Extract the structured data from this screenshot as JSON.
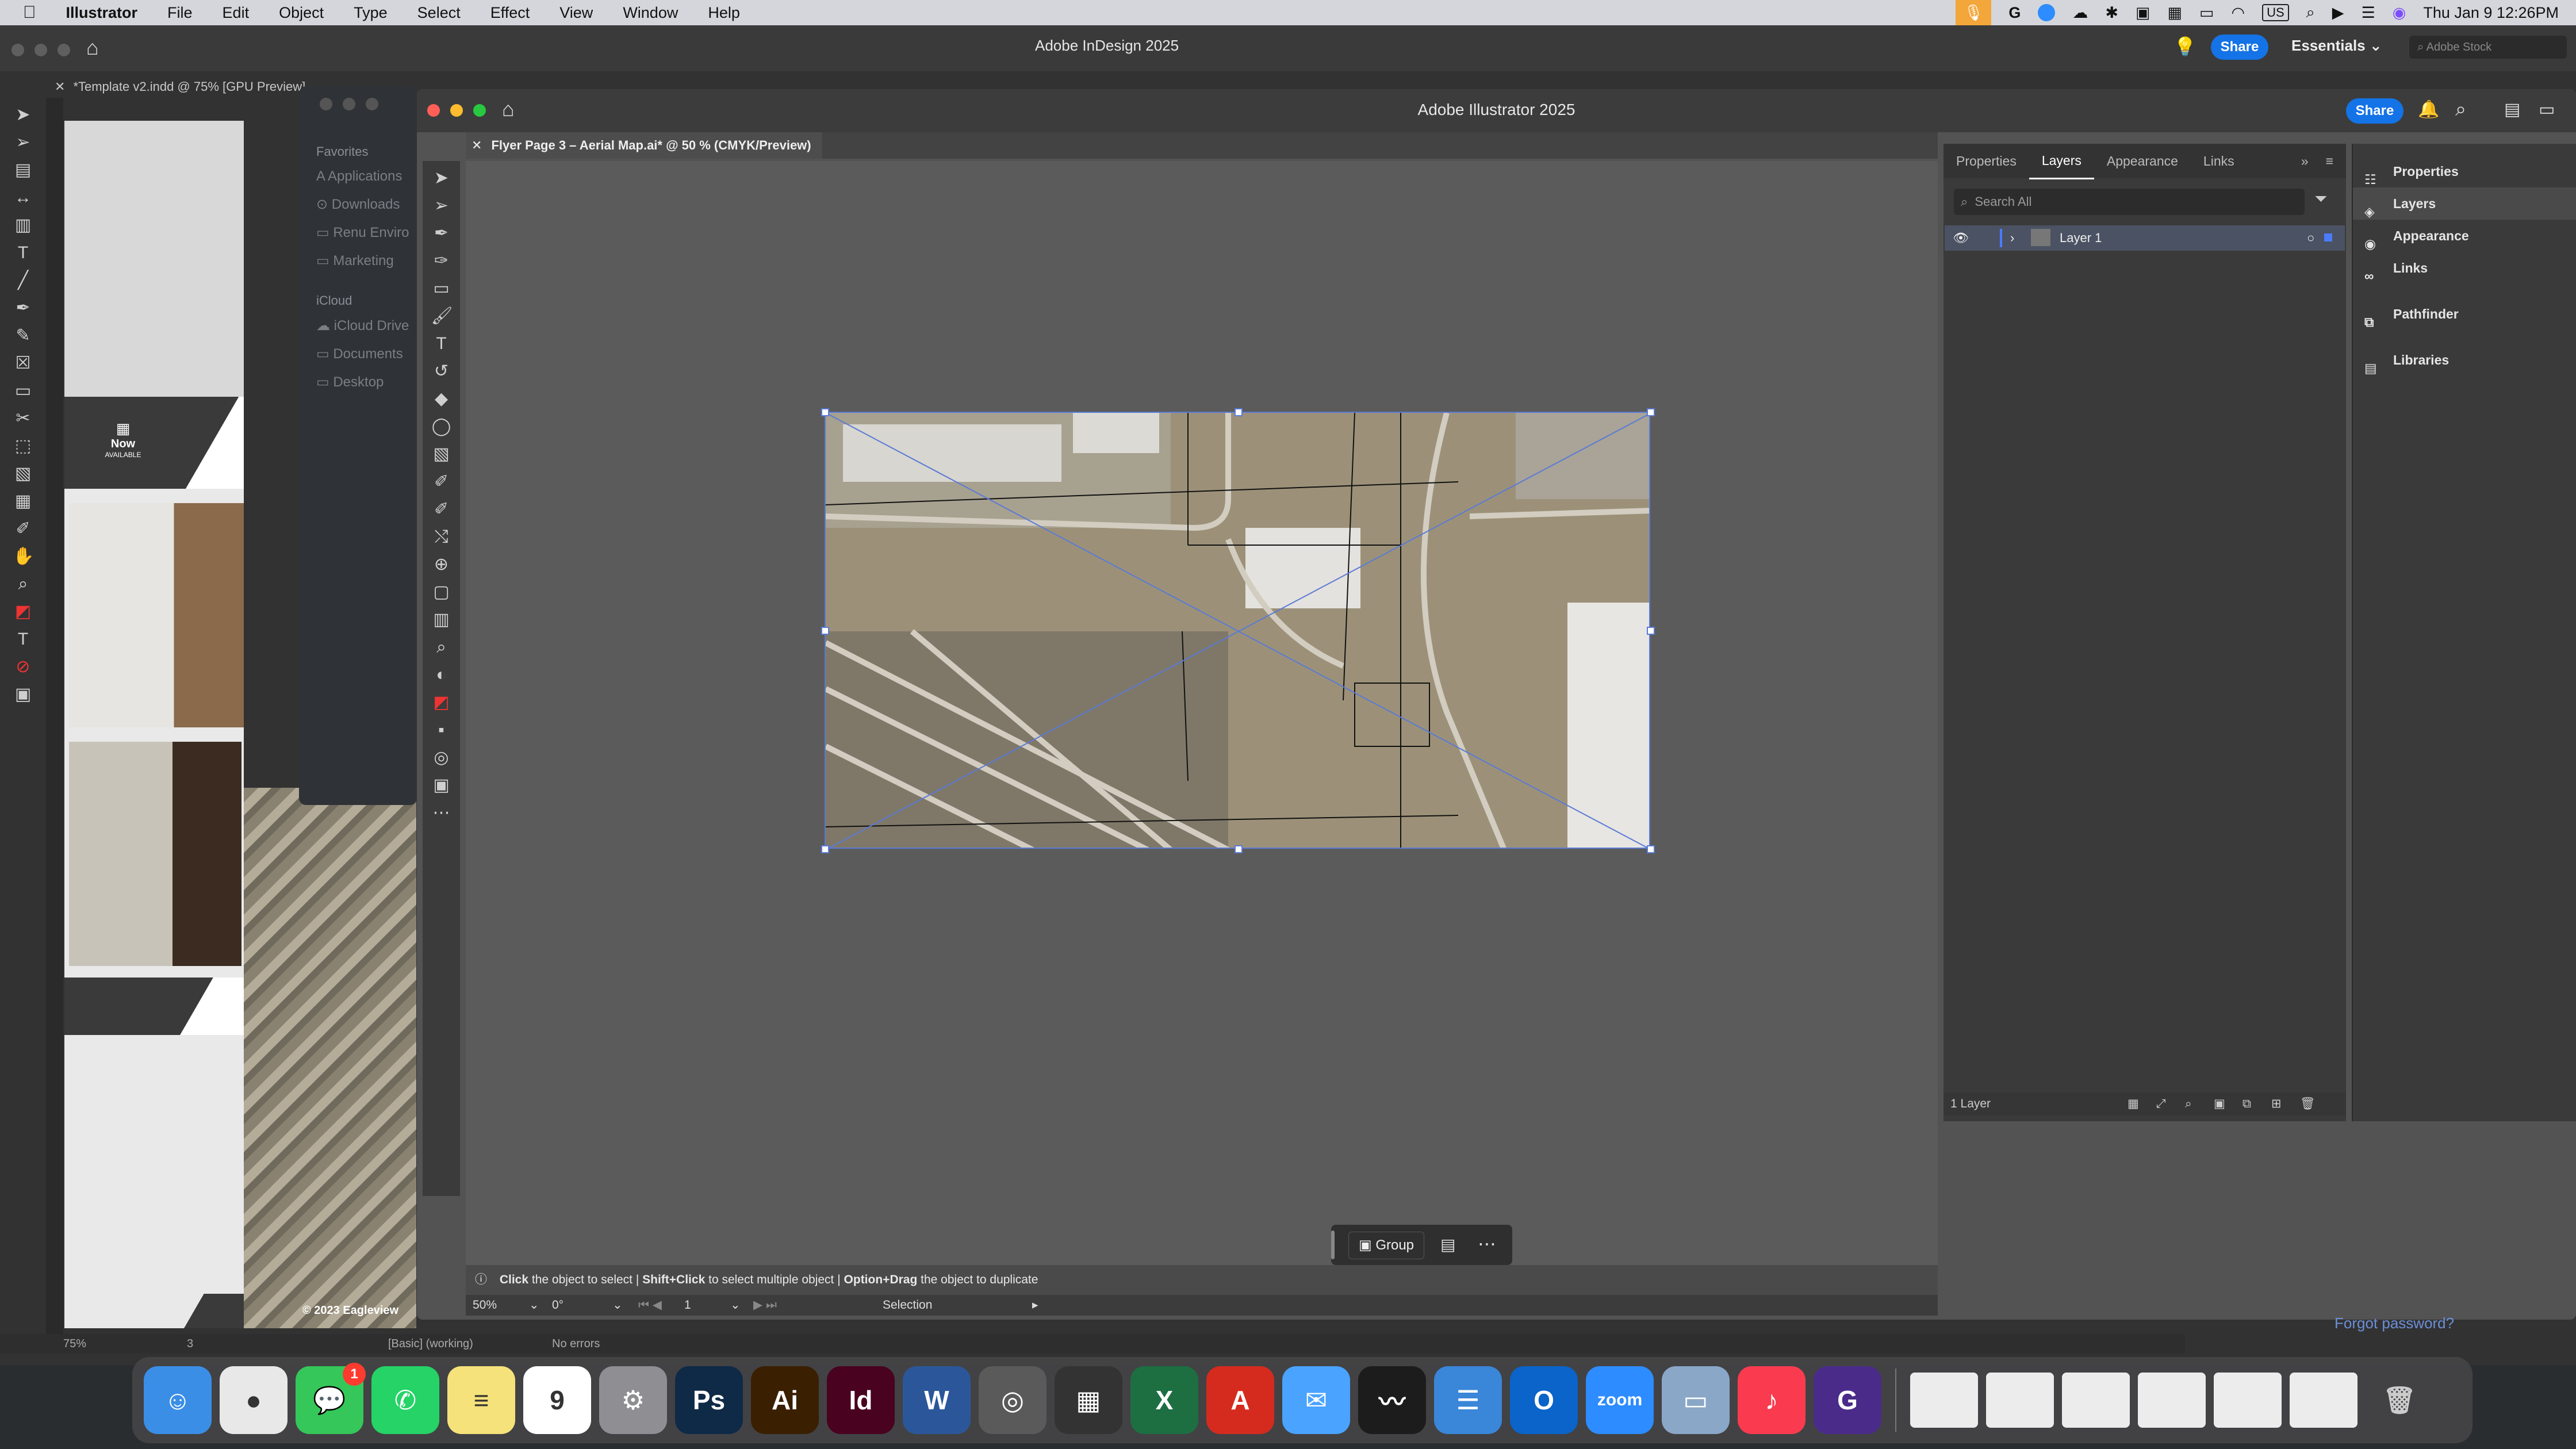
{
  "menubar": {
    "app_name": "Illustrator",
    "items": [
      "File",
      "Edit",
      "Object",
      "Type",
      "Select",
      "Effect",
      "View",
      "Window",
      "Help"
    ],
    "input_source": "US",
    "datetime": "Thu Jan 9  12:26PM"
  },
  "indesign": {
    "window_title": "Adobe InDesign 2025",
    "doc_tab": "*Template v2.indd @ 75% [GPU Preview]",
    "share_label": "Share",
    "workspace": "Essentials",
    "stock_search_placeholder": "Adobe Stock",
    "now_label": "Now",
    "now_sub": "AVAILABLE",
    "zoom": "75%",
    "page_number": "3",
    "style": "[Basic] (working)",
    "errors": "No errors",
    "credit": "© 2023 Eagleview"
  },
  "finder": {
    "favorites_header": "Favorites",
    "favorites": [
      "Applications",
      "Downloads",
      "Renu Enviro",
      "Marketing"
    ],
    "icloud_header": "iCloud",
    "icloud": [
      "iCloud Drive",
      "Documents",
      "Desktop"
    ]
  },
  "illustrator": {
    "window_title": "Adobe Illustrator 2025",
    "share_label": "Share",
    "doc_tab": "Flyer Page 3 – Aerial Map.ai* @ 50 % (CMYK/Preview)",
    "panel_tabs": [
      "Properties",
      "Layers",
      "Appearance",
      "Links"
    ],
    "active_panel_tab": "Layers",
    "search_placeholder": "Search All",
    "layer_name": "Layer 1",
    "layers_count": "1 Layer",
    "right_panels": [
      "Properties",
      "Layers",
      "Appearance",
      "Links",
      "Pathfinder",
      "Libraries"
    ],
    "selected_right_panel": "Layers",
    "context_group_label": "Group",
    "hint_click": "Click",
    "hint_click_text": "the object to select",
    "hint_shift": "Shift+Click",
    "hint_shift_text": "to select multiple object",
    "hint_option": "Option+Drag",
    "hint_option_text": "the object to duplicate",
    "zoom": "50%",
    "rotation": "0°",
    "artboard": "1",
    "tool_status": "Selection"
  },
  "desktop": {
    "forgot_password": "Forgot password?"
  },
  "dock": {
    "apps": [
      {
        "name": "Finder",
        "glyph": "☺",
        "color": "#3a8ee6"
      },
      {
        "name": "Chrome",
        "glyph": "●",
        "color": "#e8e8e8"
      },
      {
        "name": "Messages",
        "glyph": "💬",
        "color": "#35c759",
        "badge": "1"
      },
      {
        "name": "WhatsApp",
        "glyph": "✆",
        "color": "#25d366"
      },
      {
        "name": "Notes",
        "glyph": "≡",
        "color": "#f5e27a"
      },
      {
        "name": "Calendar",
        "glyph": "9",
        "color": "#ffffff"
      },
      {
        "name": "System Settings",
        "glyph": "⚙",
        "color": "#8e8e93"
      },
      {
        "name": "Photoshop",
        "glyph": "Ps",
        "color": "#0f2a47"
      },
      {
        "name": "Illustrator",
        "glyph": "Ai",
        "color": "#3a1f00"
      },
      {
        "name": "InDesign",
        "glyph": "Id",
        "color": "#49021f"
      },
      {
        "name": "Word",
        "glyph": "W",
        "color": "#2b579a"
      },
      {
        "name": "Screenshot",
        "glyph": "◎",
        "color": "#5a5a5a"
      },
      {
        "name": "Calculator",
        "glyph": "▦",
        "color": "#333333"
      },
      {
        "name": "Excel",
        "glyph": "X",
        "color": "#1d6f42"
      },
      {
        "name": "Acrobat",
        "glyph": "A",
        "color": "#d52b1e"
      },
      {
        "name": "Mail",
        "glyph": "✉",
        "color": "#4aa3ff"
      },
      {
        "name": "Activity Monitor",
        "glyph": "〰",
        "color": "#1c1c1c"
      },
      {
        "name": "Text Editor",
        "glyph": "☰",
        "color": "#3a86d9"
      },
      {
        "name": "Outlook",
        "glyph": "O",
        "color": "#0a64c9"
      },
      {
        "name": "Zoom",
        "glyph": "zoom",
        "color": "#2d8cff"
      },
      {
        "name": "Preview",
        "glyph": "▭",
        "color": "#8aa7c8"
      },
      {
        "name": "Music",
        "glyph": "♪",
        "color": "#fa3b4f"
      },
      {
        "name": "Grammarly",
        "glyph": "G",
        "color": "#4a2b8a"
      }
    ]
  },
  "colors": {
    "selection_blue": "#5a7ad6",
    "share_blue": "#1473e6",
    "menu_bar": "#d4d6dc",
    "mic_orange": "#f3a63a"
  }
}
